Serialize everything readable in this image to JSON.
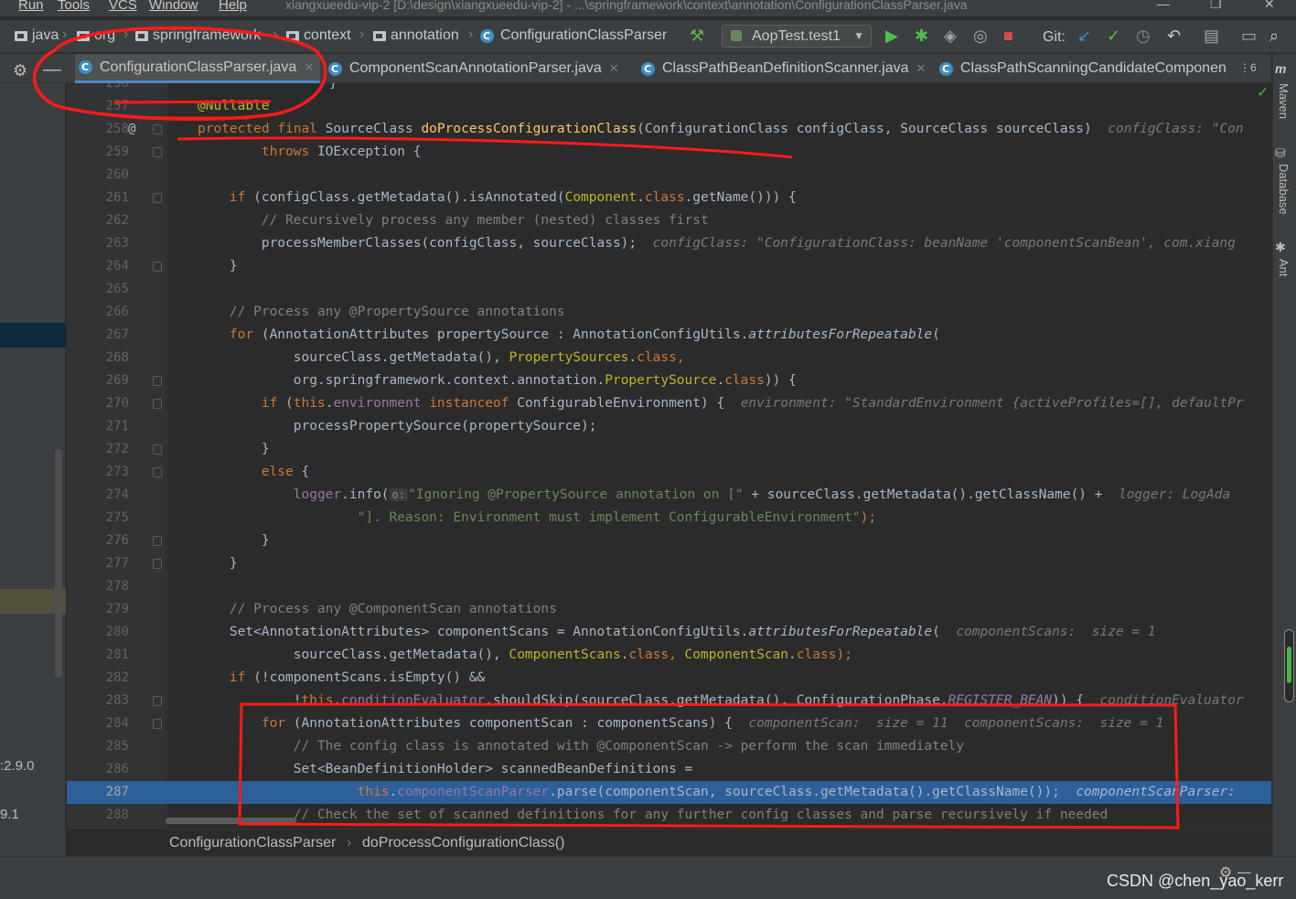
{
  "menubar": {
    "items": [
      "Run",
      "Tools",
      "VCS",
      "Window",
      "Help"
    ],
    "window_title": "xiangxueedu-vip-2 [D:\\design\\xiangxueedu-vip-2] - ...\\springframework\\context\\annotation\\ConfigurationClassParser.java"
  },
  "breadcrumbs": {
    "items": [
      "java",
      "org",
      "springframework",
      "context",
      "annotation",
      "ConfigurationClassParser"
    ]
  },
  "toolbar": {
    "run_config": "AopTest.test1",
    "git_label": "Git:"
  },
  "tabs": [
    {
      "label": "ConfigurationClassParser.java",
      "active": true
    },
    {
      "label": "ComponentScanAnnotationParser.java",
      "active": false
    },
    {
      "label": "ClassPathBeanDefinitionScanner.java",
      "active": false
    },
    {
      "label": "ClassPathScanningCandidateComponen",
      "active": false
    }
  ],
  "tab_overflow": "⋮6",
  "left_panel": {
    "text1": ":2.9.0",
    "text2": "9.1"
  },
  "editor": {
    "current_line": 287,
    "lines": [
      {
        "n": "256"
      },
      {
        "n": "257"
      },
      {
        "n": "258"
      },
      {
        "n": "259"
      },
      {
        "n": "260"
      },
      {
        "n": "261"
      },
      {
        "n": "262"
      },
      {
        "n": "263"
      },
      {
        "n": "264"
      },
      {
        "n": "265"
      },
      {
        "n": "266"
      },
      {
        "n": "267"
      },
      {
        "n": "268"
      },
      {
        "n": "269"
      },
      {
        "n": "270"
      },
      {
        "n": "271"
      },
      {
        "n": "272"
      },
      {
        "n": "273"
      },
      {
        "n": "274"
      },
      {
        "n": "275"
      },
      {
        "n": "276"
      },
      {
        "n": "277"
      },
      {
        "n": "278"
      },
      {
        "n": "279"
      },
      {
        "n": "280"
      },
      {
        "n": "281"
      },
      {
        "n": "282"
      },
      {
        "n": "283"
      },
      {
        "n": "284"
      },
      {
        "n": "285"
      },
      {
        "n": "286"
      },
      {
        "n": "287"
      },
      {
        "n": "288"
      }
    ],
    "code": {
      "l257_ann": "@Nullable",
      "l258_kw": "protected final ",
      "l258_type": "SourceClass ",
      "l258_fn": "doProcessConfigurationClass",
      "l258_params": "(ConfigurationClass configClass, SourceClass sourceClass)",
      "l258_hint": "configClass: \"Con",
      "l259_kw": "throws ",
      "l259_rest": "IOException {",
      "l261_kw": "if ",
      "l261_a": "(configClass.getMetadata().isAnnotated(",
      "l261_b": "Component",
      "l261_c": ".",
      "l261_d": "class",
      "l261_e": ".getName())) {",
      "l262_cmt": "// Recursively process any member (nested) classes first",
      "l263_code": "processMemberClasses(configClass, sourceClass);",
      "l263_hint": "configClass: \"ConfigurationClass: beanName 'componentScanBean', com.xiang",
      "l264_code": "}",
      "l266_cmt": "// Process any @PropertySource annotations",
      "l267_kw": "for ",
      "l267_a": "(AnnotationAttributes propertySource : AnnotationConfigUtils.",
      "l267_b": "attributesForRepeatable",
      "l267_c": "(",
      "l268_a": "sourceClass.getMetadata(), ",
      "l268_b": "PropertySources",
      "l268_c": ".",
      "l268_d": "class",
      "l268_e": ",",
      "l269_a": "org.springframework.context.annotation.",
      "l269_b": "PropertySource",
      "l269_c": ".",
      "l269_d": "class",
      "l269_e": ")) {",
      "l270_kw": "if ",
      "l270_a": "(",
      "l270_this": "this",
      "l270_b": ".",
      "l270_fld": "environment ",
      "l270_inst": "instanceof ",
      "l270_c": "ConfigurableEnvironment) {",
      "l270_hint": "environment: \"StandardEnvironment {activeProfiles=[], defaultPr",
      "l271_code": "processPropertySource(propertySource);",
      "l272_code": "}",
      "l273_kw": "else ",
      "l273_rest": "{",
      "l274_fld": "logger",
      "l274_a": ".info(",
      "l274_o": "o:",
      "l274_str": "\"Ignoring @PropertySource annotation on [\"",
      "l274_b": " + sourceClass.getMetadata().getClassName() +",
      "l274_hint": "logger: LogAda",
      "l275_str": "\"]. Reason: Environment must implement ConfigurableEnvironment\"",
      "l275_b": ");",
      "l276_code": "}",
      "l277_code": "}",
      "l279_cmt": "// Process any @ComponentScan annotations",
      "l280_a": "Set<AnnotationAttributes> componentScans = AnnotationConfigUtils.",
      "l280_b": "attributesForRepeatable",
      "l280_c": "(",
      "l280_hint": "componentScans:  size = 1",
      "l281_a": "sourceClass.getMetadata(), ",
      "l281_b": "ComponentScans",
      "l281_c": ".",
      "l281_d": "class",
      "l281_e": ", ",
      "l281_f": "ComponentScan",
      "l281_g": ".",
      "l281_h": "class",
      "l281_i": ");",
      "l282_kw": "if ",
      "l282_rest": "(!componentScans.isEmpty() &&",
      "l283_a": "!",
      "l283_this": "this",
      "l283_b": ".",
      "l283_fld": "conditionEvaluator",
      "l283_c": ".shouldSkip(sourceClass.getMetadata(), ConfigurationPhase.",
      "l283_d": "REGISTER_BEAN",
      "l283_e": ")) {",
      "l283_hint": "conditionEvaluator",
      "l284_kw": "for ",
      "l284_rest": "(AnnotationAttributes componentScan : componentScans) {",
      "l284_hint": "componentScan:  size = 11  componentScans:  size = 1",
      "l285_cmt": "// The config class is annotated with @ComponentScan -> perform the scan immediately",
      "l286_code": "Set<BeanDefinitionHolder> scannedBeanDefinitions =",
      "l287_this": "this",
      "l287_a": ".",
      "l287_fld": "componentScanParser",
      "l287_b": ".parse(componentScan, sourceClass.getMetadata().getClassName());",
      "l287_hint": "componentScanParser:",
      "l288_cmt": "// Check the set of scanned definitions for any further config classes and parse recursively if needed"
    }
  },
  "editor_breadcrumbs": {
    "class": "ConfigurationClassParser",
    "method": "doProcessConfigurationClass()"
  },
  "right_tools": [
    "Maven",
    "Database",
    "Ant"
  ],
  "watermark": "CSDN @chen_yao_kerr",
  "colors": {
    "bg": "#2b2b2b",
    "panel": "#3c3f41",
    "keyword": "#cc7832",
    "string": "#6a8759",
    "comment": "#808080",
    "annotation": "#bbb529",
    "function": "#ffc66d",
    "field": "#9876aa",
    "current_line": "#2d6099",
    "red_markup": "#ff1a1a"
  }
}
